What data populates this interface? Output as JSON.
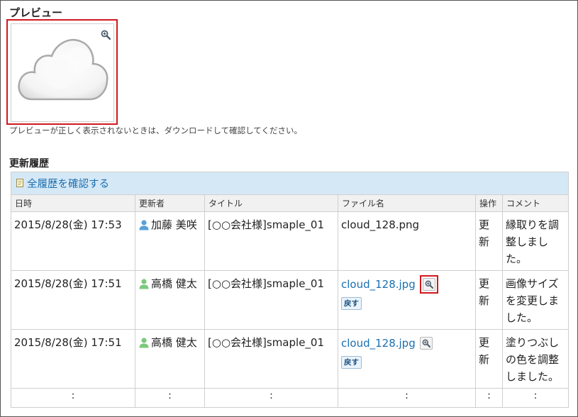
{
  "preview": {
    "title": "プレビュー",
    "note": "プレビューが正しく表示されないときは、ダウンロードして確認してください。"
  },
  "history": {
    "title": "更新履歴",
    "all_link": "全履歴を確認する",
    "columns": [
      "日時",
      "更新者",
      "タイトル",
      "ファイル名",
      "操作",
      "コメント"
    ],
    "rows": [
      {
        "datetime": "2015/8/28(金) 17:53",
        "user": "加藤 美咲",
        "title": "[○○会社様]smaple_01",
        "file": "cloud_128.png",
        "op": "更新",
        "comment": "縁取りを調整しました。"
      },
      {
        "datetime": "2015/8/28(金) 17:51",
        "user": "高橋 健太",
        "title": "[○○会社様]smaple_01",
        "file": "cloud_128.jpg",
        "back": "戻す",
        "op": "更新",
        "comment": "画像サイズを変更しました。"
      },
      {
        "datetime": "2015/8/28(金) 17:51",
        "user": "高橋 健太",
        "title": "[○○会社様]smaple_01",
        "file": "cloud_128.jpg",
        "back": "戻す",
        "op": "更新",
        "comment": "塗りつぶしの色を調整しました。"
      }
    ],
    "ellipsis": ":"
  },
  "colors": {
    "accent": "#1a6fb0",
    "highlight": "#d0191e",
    "header_bg": "#d5e8f6",
    "user_blue": "#5aa0d8",
    "user_green": "#7cc87c"
  },
  "icons": [
    "zoom-icon",
    "document-icon",
    "user-icon",
    "cloud-image"
  ]
}
